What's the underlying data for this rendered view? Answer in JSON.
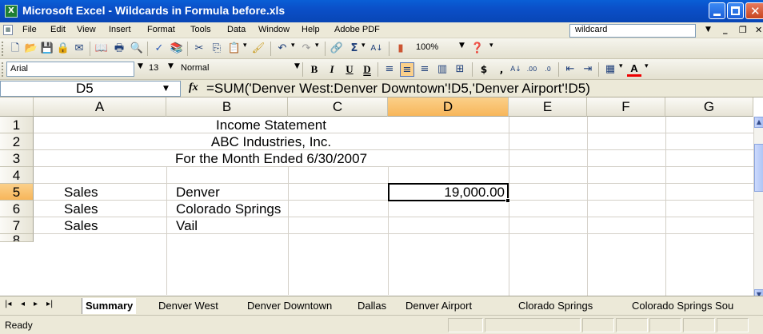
{
  "window": {
    "title": "Microsoft Excel - Wildcards in Formula before.xls",
    "app_icon": "excel-icon"
  },
  "menu": {
    "items": [
      "File",
      "Edit",
      "View",
      "Insert",
      "Format",
      "Tools",
      "Data",
      "Window",
      "Help",
      "Adobe PDF"
    ],
    "help_box_value": "wildcard"
  },
  "toolbar": {
    "zoom": "100%"
  },
  "format_toolbar": {
    "font_name": "Arial",
    "font_size": "13",
    "style": "Normal"
  },
  "formula_bar": {
    "name_box": "D5",
    "fx_label": "fx",
    "formula": "=SUM('Denver West:Denver Downtown'!D5,'Denver Airport'!D5)"
  },
  "grid": {
    "columns": [
      "A",
      "B",
      "C",
      "D",
      "E",
      "F",
      "G"
    ],
    "selected_column": "D",
    "rows": [
      "1",
      "2",
      "3",
      "4",
      "5",
      "6",
      "7",
      "8"
    ],
    "selected_row": "5",
    "header_lines": [
      "Income Statement",
      "ABC Industries, Inc.",
      "For the Month Ended 6/30/2007"
    ],
    "data_rows": [
      {
        "row": "5",
        "a": "Sales",
        "b": "Denver",
        "d": "19,000.00"
      },
      {
        "row": "6",
        "a": "Sales",
        "b": "Colorado Springs",
        "d": ""
      },
      {
        "row": "7",
        "a": "Sales",
        "b": "Vail",
        "d": ""
      }
    ]
  },
  "sheet_tabs": [
    "Summary",
    "Denver West",
    "Denver Downtown",
    "Dallas",
    "Denver Airport",
    "Clorado Springs",
    "Colorado Springs Sou"
  ],
  "status": {
    "text": "Ready"
  }
}
